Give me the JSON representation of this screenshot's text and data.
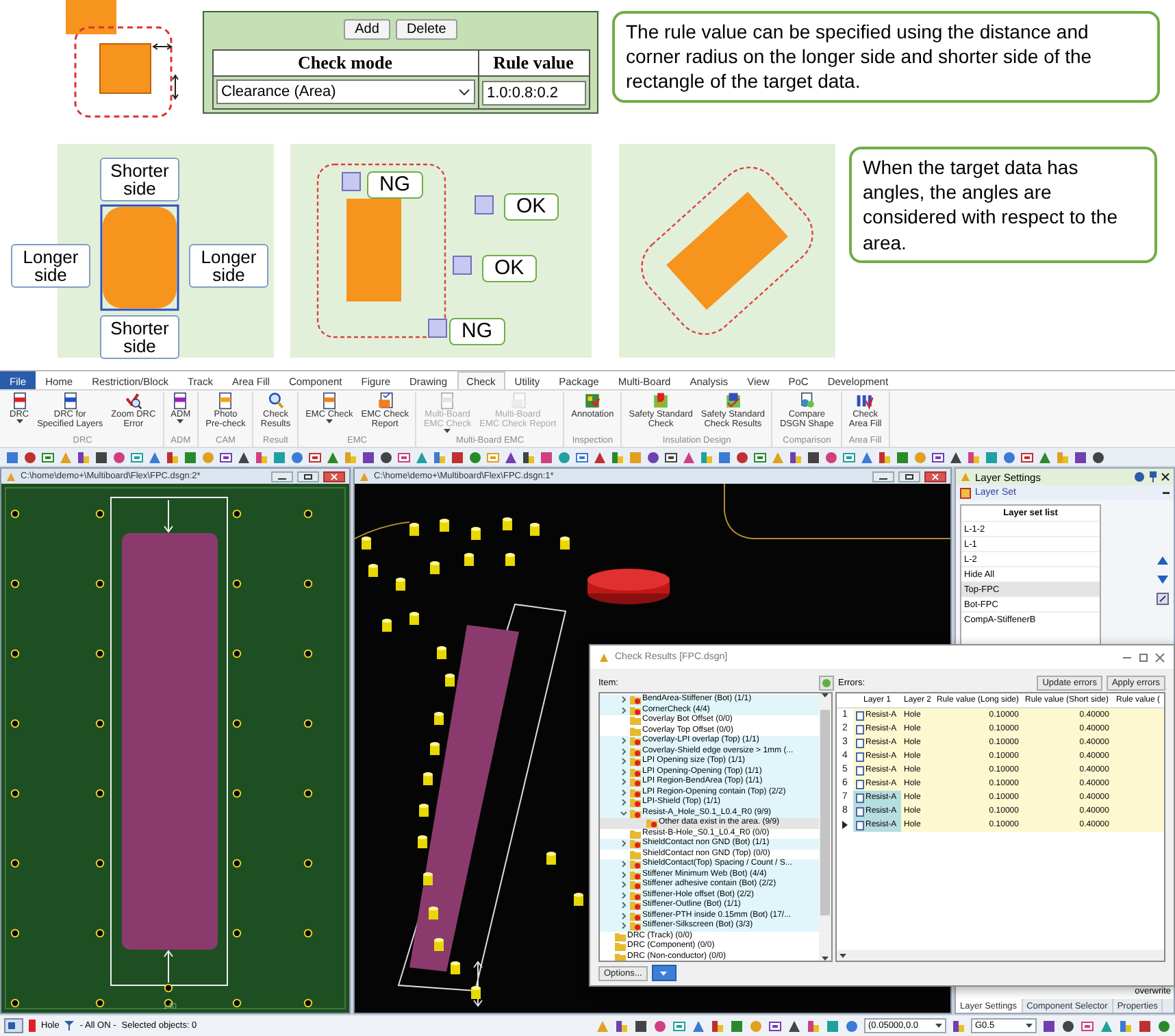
{
  "explainer": {
    "rule_editor": {
      "buttons": [
        "Add",
        "Delete"
      ],
      "columns": [
        "Check mode",
        "Rule value"
      ],
      "check_mode": "Clearance (Area)",
      "rule_value": "1.0:0.8:0.2"
    },
    "note_rule": "The rule value can be specified using the distance and corner radius on the longer side and shorter side of the rectangle of the target data.",
    "side_labels": {
      "top": "Shorter side",
      "left": "Longer side",
      "right": "Longer side",
      "bottom": "Shorter side"
    },
    "judgements": [
      "NG",
      "OK",
      "OK",
      "NG"
    ],
    "note_angles": "When the target data has angles, the angles are considered with respect to the area."
  },
  "app": {
    "menu_tabs": [
      {
        "label": "File",
        "kind": "file",
        "selected": false
      },
      {
        "label": "Home",
        "kind": "tab",
        "selected": false
      },
      {
        "label": "Restriction/Block",
        "kind": "tab",
        "selected": false
      },
      {
        "label": "Track",
        "kind": "tab",
        "selected": false
      },
      {
        "label": "Area Fill",
        "kind": "tab",
        "selected": false
      },
      {
        "label": "Component",
        "kind": "tab",
        "selected": false
      },
      {
        "label": "Figure",
        "kind": "tab",
        "selected": false
      },
      {
        "label": "Drawing",
        "kind": "tab",
        "selected": false
      },
      {
        "label": "Check",
        "kind": "tab",
        "selected": true
      },
      {
        "label": "Utility",
        "kind": "tab",
        "selected": false
      },
      {
        "label": "Package",
        "kind": "tab",
        "selected": false
      },
      {
        "label": "Multi-Board",
        "kind": "tab",
        "selected": false
      },
      {
        "label": "Analysis",
        "kind": "tab",
        "selected": false
      },
      {
        "label": "View",
        "kind": "tab",
        "selected": false
      },
      {
        "label": "PoC",
        "kind": "tab",
        "selected": false
      },
      {
        "label": "Development",
        "kind": "tab",
        "selected": false
      }
    ],
    "ribbon_groups": [
      {
        "label": "DRC",
        "buttons": [
          {
            "label": "DRC",
            "dropdown": true,
            "disabled": false
          },
          {
            "label": "DRC for\nSpecified Layers",
            "dropdown": false,
            "disabled": false
          },
          {
            "label": "Zoom DRC\nError",
            "dropdown": false,
            "disabled": false
          }
        ]
      },
      {
        "label": "ADM",
        "buttons": [
          {
            "label": "ADM",
            "dropdown": true,
            "disabled": false
          }
        ]
      },
      {
        "label": "CAM",
        "buttons": [
          {
            "label": "Photo\nPre-check",
            "dropdown": false,
            "disabled": false
          }
        ]
      },
      {
        "label": "Result",
        "buttons": [
          {
            "label": "Check\nResults",
            "dropdown": false,
            "disabled": false
          }
        ]
      },
      {
        "label": "EMC",
        "buttons": [
          {
            "label": "EMC Check",
            "dropdown": true,
            "disabled": false
          },
          {
            "label": "EMC Check\nReport",
            "dropdown": false,
            "disabled": false
          }
        ]
      },
      {
        "label": "Multi-Board EMC",
        "buttons": [
          {
            "label": "Multi-Board\nEMC Check",
            "dropdown": true,
            "disabled": true
          },
          {
            "label": "Multi-Board\nEMC Check Report",
            "dropdown": false,
            "disabled": true
          }
        ]
      },
      {
        "label": "Inspection",
        "buttons": [
          {
            "label": "Annotation",
            "dropdown": false,
            "disabled": false
          }
        ]
      },
      {
        "label": "Insulation Design",
        "buttons": [
          {
            "label": "Safety Standard\nCheck",
            "dropdown": false,
            "disabled": false
          },
          {
            "label": "Safety Standard\nCheck Results",
            "dropdown": false,
            "disabled": false
          }
        ]
      },
      {
        "label": "Comparison",
        "buttons": [
          {
            "label": "Compare\nDSGN Shape",
            "dropdown": false,
            "disabled": false
          }
        ]
      },
      {
        "label": "Area Fill",
        "buttons": [
          {
            "label": "Check\nArea Fill",
            "dropdown": false,
            "disabled": false
          }
        ]
      }
    ],
    "documents": [
      {
        "kind": "board",
        "title": "C:\\home\\demo+\\Multiboard\\Flex\\FPC.dsgn:2*",
        "ruler_label": "140"
      },
      {
        "kind": "view3d",
        "title": "C:\\home\\demo+\\Multiboard\\Flex\\FPC.dsgn:1*"
      }
    ],
    "layer_panel": {
      "title": "Layer Settings",
      "section": "Layer Set",
      "list_header": "Layer set list",
      "items": [
        {
          "label": "L-1-2",
          "selected": false
        },
        {
          "label": "L-1",
          "selected": false
        },
        {
          "label": "L-2",
          "selected": false
        },
        {
          "label": "Hide All",
          "selected": false
        },
        {
          "label": "Top-FPC",
          "selected": true
        },
        {
          "label": "Bot-FPC",
          "selected": false
        },
        {
          "label": "CompA-StiffenerB",
          "selected": false
        }
      ],
      "overwrite_label": "overwrite",
      "tabs": [
        {
          "label": "Layer Settings",
          "selected": true
        },
        {
          "label": "Component Selector",
          "selected": false
        },
        {
          "label": "Properties",
          "selected": false
        }
      ]
    },
    "check_results": {
      "title": "Check Results [FPC.dsgn]",
      "items_label": "Item:",
      "errors_label": "Errors:",
      "buttons": [
        "Update errors",
        "Apply errors"
      ],
      "tree": [
        {
          "kind": "scrolled_parent",
          "children": [
            {
              "label": "BendArea-Stiffener (Bot) (1/1)",
              "expanded": false,
              "error": true,
              "selected": false
            },
            {
              "label": "CornerCheck (4/4)",
              "expanded": false,
              "error": true,
              "selected": false
            },
            {
              "label": "Coverlay Bot Offset (0/0)",
              "error": false,
              "selected": false
            },
            {
              "label": "Coverlay Top Offset (0/0)",
              "error": false,
              "selected": false
            },
            {
              "label": "Coverlay-LPI overlap (Top) (1/1)",
              "expanded": false,
              "error": true,
              "selected": false
            },
            {
              "label": "Coverlay-Shield edge oversize > 1mm (...",
              "expanded": false,
              "error": true,
              "selected": false
            },
            {
              "label": "LPI Opening size (Top) (1/1)",
              "expanded": false,
              "error": true,
              "selected": false
            },
            {
              "label": "LPI Opening-Opening (Top) (1/1)",
              "expanded": false,
              "error": true,
              "selected": false
            },
            {
              "label": "LPI Region-BendArea (Top) (1/1)",
              "expanded": false,
              "error": true,
              "selected": false
            },
            {
              "label": "LPI Region-Opening contain (Top) (2/2)",
              "expanded": false,
              "error": true,
              "selected": false
            },
            {
              "label": "LPI-Shield (Top) (1/1)",
              "expanded": false,
              "error": true,
              "selected": false
            },
            {
              "label": "Resist-A_Hole_S0.1_L0.4_R0 (9/9)",
              "expanded": true,
              "error": true,
              "selected": false,
              "children": [
                {
                  "label": "Other data exist in the area. (9/9)",
                  "error": true,
                  "selected": true
                }
              ]
            },
            {
              "label": "Resist-B-Hole_S0.1_L0.4_R0 (0/0)",
              "error": false,
              "selected": false
            },
            {
              "label": "ShieldContact non GND (Bot) (1/1)",
              "expanded": false,
              "error": true,
              "selected": false
            },
            {
              "label": "ShieldContact non GND (Top) (0/0)",
              "error": false,
              "selected": false
            },
            {
              "label": "ShieldContact(Top) Spacing / Count / S...",
              "expanded": false,
              "error": true,
              "selected": false
            },
            {
              "label": "Stiffener Minimum Web (Bot) (4/4)",
              "expanded": false,
              "error": true,
              "selected": false
            },
            {
              "label": "Stiffener adhesive contain (Bot) (2/2)",
              "expanded": false,
              "error": true,
              "selected": false
            },
            {
              "label": "Stiffener-Hole offset (Bot) (2/2)",
              "expanded": false,
              "error": true,
              "selected": false
            },
            {
              "label": "Stiffener-Outline (Bot) (1/1)",
              "expanded": false,
              "error": true,
              "selected": false
            },
            {
              "label": "Stiffener-PTH inside 0.15mm (Bot) (17/...",
              "expanded": false,
              "error": true,
              "selected": false
            },
            {
              "label": "Stiffener-Silkscreen (Bot) (3/3)",
              "expanded": false,
              "error": true,
              "selected": false
            }
          ]
        },
        {
          "kind": "folder",
          "label": "DRC (Track) (0/0)",
          "error": false,
          "selected": false
        },
        {
          "kind": "folder",
          "label": "DRC (Component) (0/0)",
          "error": false,
          "selected": false
        },
        {
          "kind": "folder",
          "label": "DRC (Non-conductor) (0/0)",
          "error": false,
          "selected": false
        }
      ],
      "columns": [
        "Layer 1",
        "Layer 2",
        "Rule value (Long side)",
        "Rule value (Short side)",
        "Rule value ("
      ],
      "rows": [
        {
          "number": "1",
          "layer1": "Resist-A",
          "layer2": "Hole",
          "long": "0.10000",
          "short": "0.40000",
          "selected": false,
          "current": false
        },
        {
          "number": "2",
          "layer1": "Resist-A",
          "layer2": "Hole",
          "long": "0.10000",
          "short": "0.40000",
          "selected": false,
          "current": false
        },
        {
          "number": "3",
          "layer1": "Resist-A",
          "layer2": "Hole",
          "long": "0.10000",
          "short": "0.40000",
          "selected": false,
          "current": false
        },
        {
          "number": "4",
          "layer1": "Resist-A",
          "layer2": "Hole",
          "long": "0.10000",
          "short": "0.40000",
          "selected": false,
          "current": false
        },
        {
          "number": "5",
          "layer1": "Resist-A",
          "layer2": "Hole",
          "long": "0.10000",
          "short": "0.40000",
          "selected": false,
          "current": false
        },
        {
          "number": "6",
          "layer1": "Resist-A",
          "layer2": "Hole",
          "long": "0.10000",
          "short": "0.40000",
          "selected": false,
          "current": false
        },
        {
          "number": "7",
          "layer1": "Resist-A",
          "layer2": "Hole",
          "long": "0.10000",
          "short": "0.40000",
          "selected": true,
          "current": false
        },
        {
          "number": "8",
          "layer1": "Resist-A",
          "layer2": "Hole",
          "long": "0.10000",
          "short": "0.40000",
          "selected": true,
          "current": false
        },
        {
          "layer1": "Resist-A",
          "layer2": "Hole",
          "long": "0.10000",
          "short": "0.40000",
          "selected": true,
          "current": true
        }
      ],
      "options_button": "Options..."
    },
    "status_bar": {
      "layer": "Hole",
      "filter": "- All ON -",
      "selection": "Selected objects: 0",
      "coordinate": "(0.05000,0.0",
      "grid": "G0.5"
    }
  }
}
